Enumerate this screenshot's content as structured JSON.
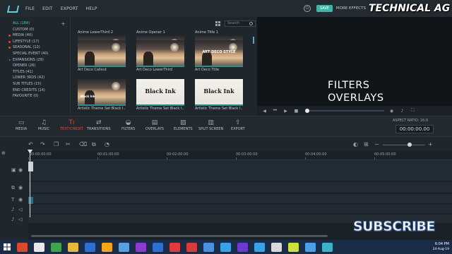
{
  "menubar": {
    "items": [
      "FILE",
      "EDIT",
      "EXPORT",
      "HELP"
    ],
    "save_label": "SAVE",
    "more_effects_label": "MORE EFFECTS",
    "channel_name": "TECHNICAL AG"
  },
  "categories": {
    "items": [
      {
        "label": "ALL (184)",
        "active": true
      },
      {
        "label": "CUSTOM (0)"
      },
      {
        "label": "MEDIA (40)"
      },
      {
        "label": "LIFESTYLE (17)"
      },
      {
        "label": "SEASONAL (12)"
      },
      {
        "label": "SPECIAL EVENT (40)"
      },
      {
        "label": "EXPANSIONS (29)"
      },
      {
        "label": "OPENER (26)"
      },
      {
        "label": "TITLES (41)"
      },
      {
        "label": "LOWER 3RDS (42)"
      },
      {
        "label": "SUB TITLES (15)"
      },
      {
        "label": "END CREDITS (14)"
      },
      {
        "label": "FAVOURITE (0)"
      }
    ]
  },
  "search": {
    "placeholder": "Search"
  },
  "tiles": [
    {
      "label": "Anime LowerThird 2",
      "thumb": "photo"
    },
    {
      "label": "Anime Opener 1",
      "thumb": "photo"
    },
    {
      "label": "Anime Title 1",
      "thumb": "photo"
    },
    {
      "label": "Art Deco Callout",
      "thumb": "photo"
    },
    {
      "label": "Art Deco LowerThird",
      "thumb": "photo"
    },
    {
      "label": "Art Deco Title",
      "thumb": "photo",
      "overlay": "ART DECO STYLE"
    },
    {
      "label": "Artistic Theme Set Black I...",
      "thumb": "photo",
      "overlay": "Black Ink"
    },
    {
      "label": "Artistic Theme Set Black I...",
      "thumb": "cream",
      "overlay": "Black Ink"
    },
    {
      "label": "Artistic Theme Set Black I...",
      "thumb": "cream",
      "overlay": "Black Ink"
    }
  ],
  "preview": {
    "line1": "FILTERS",
    "line2": "OVERLAYS"
  },
  "tabs": [
    {
      "label": "MEDIA",
      "icon": "folder-icon"
    },
    {
      "label": "MUSIC",
      "icon": "music-note-icon"
    },
    {
      "label": "TEXT/CREDIT",
      "icon": "text-icon",
      "active": true
    },
    {
      "label": "TRANSITIONS",
      "icon": "transitions-icon"
    },
    {
      "label": "FILTERS",
      "icon": "filter-icon"
    },
    {
      "label": "OVERLAYS",
      "icon": "overlays-icon"
    },
    {
      "label": "ELEMENTS",
      "icon": "image-icon"
    },
    {
      "label": "SPLIT SCREEN",
      "icon": "split-screen-icon"
    },
    {
      "label": "EXPORT",
      "icon": "export-icon"
    }
  ],
  "aspect_ratio": "ASPECT RATIO: 16:9",
  "timecode": "00:00:00.00",
  "ruler": [
    "00:00:00:00",
    "00:01:00:00",
    "00:02:00:00",
    "00:03:00:00",
    "00:04:00:00",
    "00:05:00:00"
  ],
  "taskbar": {
    "time": "6:04 PM",
    "date": "24-Aug-19"
  },
  "overlay_text": "SUBSCRIBE",
  "colors": {
    "accent_teal": "#3fb6a4",
    "active_red": "#ea4a3e",
    "taskbar": "#1a2b45"
  }
}
